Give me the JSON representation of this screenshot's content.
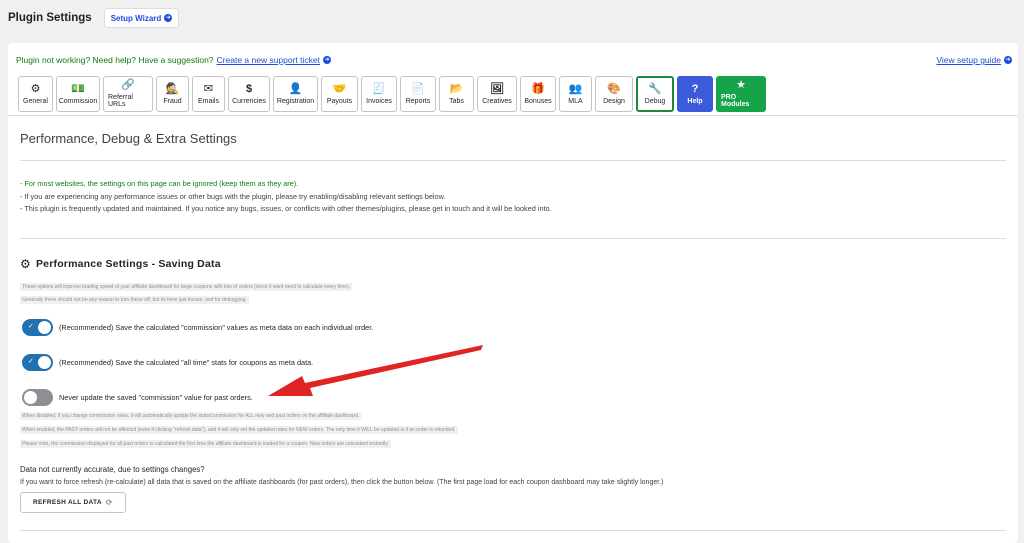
{
  "header": {
    "title": "Plugin Settings",
    "wizard_label": "Setup Wizard"
  },
  "help_bar": {
    "prompt": "Plugin not working? Need help? Have a suggestion?",
    "support_link": "Create a new support ticket",
    "guide_link": "View setup guide"
  },
  "tabs": [
    {
      "label": "General",
      "icon": "gear-icon",
      "glyph": "⚙"
    },
    {
      "label": "Commission",
      "icon": "money-icon",
      "glyph": "💵"
    },
    {
      "label": "Referral URLs",
      "icon": "link-icon",
      "glyph": "🔗"
    },
    {
      "label": "Fraud",
      "icon": "spy-icon",
      "glyph": "🕵"
    },
    {
      "label": "Emails",
      "icon": "envelope-icon",
      "glyph": "✉"
    },
    {
      "label": "Currencies",
      "icon": "dollar-icon",
      "glyph": "$"
    },
    {
      "label": "Registration",
      "icon": "user-icon",
      "glyph": "👤"
    },
    {
      "label": "Payouts",
      "icon": "handshake-icon",
      "glyph": "🤝"
    },
    {
      "label": "Invoices",
      "icon": "invoice-icon",
      "glyph": "🧾"
    },
    {
      "label": "Reports",
      "icon": "report-icon",
      "glyph": "📄"
    },
    {
      "label": "Tabs",
      "icon": "folder-plus-icon",
      "glyph": "📂"
    },
    {
      "label": "Creatives",
      "icon": "images-icon",
      "glyph": "🖼"
    },
    {
      "label": "Bonuses",
      "icon": "gift-icon",
      "glyph": "🎁"
    },
    {
      "label": "MLA",
      "icon": "users-icon",
      "glyph": "👥"
    },
    {
      "label": "Design",
      "icon": "palette-icon",
      "glyph": "🎨"
    },
    {
      "label": "Debug",
      "icon": "wrench-icon",
      "glyph": "🔧",
      "active": true
    },
    {
      "label": "Help",
      "icon": "question-icon",
      "glyph": "?",
      "style": "help"
    },
    {
      "label": "PRO Modules",
      "icon": "star-icon",
      "glyph": "★",
      "style": "pro"
    }
  ],
  "page": {
    "heading": "Performance, Debug & Extra Settings",
    "intro": [
      "- For most websites, the settings on this page can be ignored (keep them as they are).",
      "- If you are experiencing any performance issues or other bugs with the plugin, please try enabling/disabling relevant settings below.",
      "- This plugin is frequently updated and maintained. If you notice any bugs, issues, or conflicts with other themes/plugins, please get in touch and it will be looked into."
    ]
  },
  "performance": {
    "title": "Performance Settings - Saving Data",
    "notes": [
      "These options will improve loading speed of your affiliate dashboard for large coupons with lots of orders (since it wont need to calculate every time).",
      "Generally there should not be any reason to turn these off, but its here just incase, and for debugging."
    ],
    "toggles": [
      {
        "label": "(Recommended) Save the calculated \"commission\" values as meta data on each individual order.",
        "on": true
      },
      {
        "label": "(Recommended) Save the calculated \"all time\" stats for coupons as meta data.",
        "on": true
      },
      {
        "label": "Never update the saved \"commission\" value for past orders.",
        "on": false
      }
    ],
    "toggle_notes": [
      "When disabled, if you change commission rates, it will automatically update the stats/commission for ALL new and past orders on the affiliate dashboard.",
      "When enabled, the PAST orders will not be affected (even if clicking \"refresh data\"), and it will only set the updated rates for NEW orders. The only time it WILL be updated is if an order is refunded.",
      "Please note, the commission displayed for all past orders is calculated the first time the affiliate dashboard is loaded for a coupon. New orders are calculated instantly."
    ]
  },
  "refresh": {
    "question": "Data not currently accurate, due to settings changes?",
    "description": "If you want to force refresh (re-calculate) all data that is saved on the affiliate dashboards (for past orders), then click the button below. (The first page load for each coupon dashboard may take slightly longer.)",
    "button": "REFRESH ALL DATA"
  },
  "colors": {
    "accent": "#2271b1",
    "green": "#0f7b0f",
    "link": "#1d4ed8",
    "annotation_arrow": "#e02424"
  }
}
